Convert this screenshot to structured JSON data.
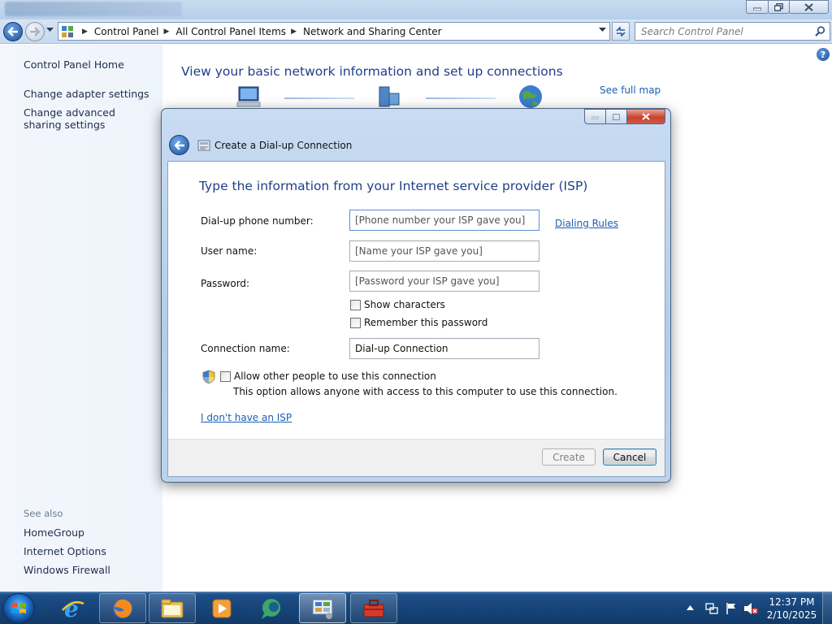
{
  "window": {
    "title": ""
  },
  "address": {
    "crumbs": [
      "Control Panel",
      "All Control Panel Items",
      "Network and Sharing Center"
    ]
  },
  "search": {
    "placeholder": "Search Control Panel"
  },
  "sidebar": {
    "home": "Control Panel Home",
    "items": [
      "Change adapter settings",
      "Change advanced sharing settings"
    ],
    "see_also_label": "See also",
    "see_also": [
      "HomeGroup",
      "Internet Options",
      "Windows Firewall"
    ]
  },
  "main": {
    "title": "View your basic network information and set up connections",
    "see_full_map": "See full map",
    "map_icons": [
      "computer-icon",
      "network-icon",
      "globe-icon"
    ]
  },
  "dialog": {
    "title": "Create a Dial-up Connection",
    "heading": "Type the information from your Internet service provider (ISP)",
    "phone_label": "Dial-up phone number:",
    "phone_placeholder": "[Phone number your ISP gave you]",
    "dialing_rules": "Dialing Rules",
    "user_label": "User name:",
    "user_placeholder": "[Name your ISP gave you]",
    "password_label": "Password:",
    "password_placeholder": "[Password your ISP gave you]",
    "show_characters": "Show characters",
    "remember_password": "Remember this password",
    "connection_label": "Connection name:",
    "connection_value": "Dial-up Connection",
    "allow_others": "Allow other people to use this connection",
    "allow_note": "This option allows anyone with access to this computer to use this connection.",
    "no_isp": "I don't have an ISP",
    "create_label": "Create",
    "cancel_label": "Cancel"
  },
  "taskbar": {
    "items": [
      "internet-explorer-icon",
      "firefox-icon",
      "file-explorer-icon",
      "media-player-icon",
      "messenger-icon",
      "control-panel-icon",
      "toolbox-icon"
    ],
    "time": "12:37 PM",
    "date": "2/10/2025"
  },
  "colors": {
    "link": "#1a5fb4",
    "heading": "#1f3f8a",
    "taskbar": "#174478"
  }
}
